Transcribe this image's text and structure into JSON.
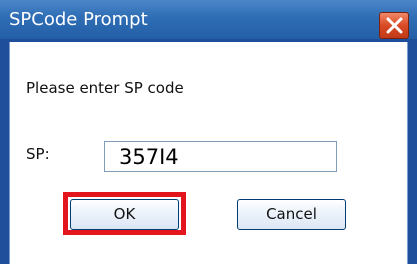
{
  "window": {
    "title": "SPCode Prompt"
  },
  "dialog": {
    "prompt": "Please enter SP code",
    "sp_label": "SP:",
    "sp_value": "357I4"
  },
  "buttons": {
    "ok_label": "OK",
    "cancel_label": "Cancel"
  },
  "colors": {
    "titlebar": "#2e6db5",
    "highlight": "#e3161d",
    "close_button": "#d94a24"
  },
  "icons": {
    "close": "close-icon"
  }
}
